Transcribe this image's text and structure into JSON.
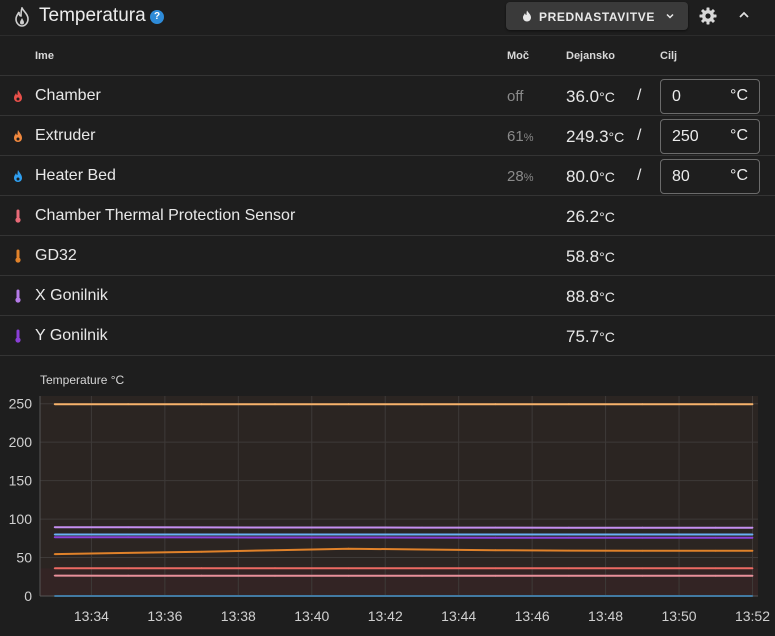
{
  "header": {
    "title": "Temperatura",
    "help_icon": "question-circle-icon",
    "help_glyph": "?",
    "preset_label": "PREDNASTAVITVE"
  },
  "table": {
    "columns": {
      "name": "Ime",
      "power": "Moč",
      "actual": "Dejansko",
      "target": "Cilj"
    },
    "rows": [
      {
        "name": "Chamber",
        "icon": "flame-icon",
        "color": "#e8504a",
        "power": "off",
        "power_unit": "",
        "actual": "36.0",
        "unit": "°C",
        "target": "0",
        "target_unit": "°C"
      },
      {
        "name": "Extruder",
        "icon": "flame-icon",
        "color": "#f0883e",
        "power": "61",
        "power_unit": "%",
        "actual": "249.3",
        "unit": "°C",
        "target": "250",
        "target_unit": "°C"
      },
      {
        "name": "Heater Bed",
        "icon": "flame-icon",
        "color": "#2f9ff0",
        "power": "28",
        "power_unit": "%",
        "actual": "80.0",
        "unit": "°C",
        "target": "80",
        "target_unit": "°C"
      },
      {
        "name": "Chamber Thermal Protection Sensor",
        "icon": "thermometer-icon",
        "color": "#e86a78",
        "actual": "26.2",
        "unit": "°C"
      },
      {
        "name": "GD32",
        "icon": "thermometer-icon",
        "color": "#e0822a",
        "actual": "58.8",
        "unit": "°C"
      },
      {
        "name": "X Gonilnik",
        "icon": "thermometer-icon",
        "color": "#b57be8",
        "actual": "88.8",
        "unit": "°C"
      },
      {
        "name": "Y Gonilnik",
        "icon": "thermometer-icon",
        "color": "#8a3fd6",
        "actual": "75.7",
        "unit": "°C"
      }
    ]
  },
  "chart_data": {
    "type": "line",
    "title": "Temperature °C",
    "xlabel": "",
    "ylabel": "",
    "ylim": [
      0,
      260
    ],
    "yticks": [
      0,
      50,
      100,
      150,
      200,
      250
    ],
    "xticks": [
      "13:34",
      "13:36",
      "13:38",
      "13:40",
      "13:42",
      "13:44",
      "13:46",
      "13:48",
      "13:50",
      "13:52"
    ],
    "x": [
      "13:33",
      "13:35",
      "13:37",
      "13:39",
      "13:41",
      "13:43",
      "13:45",
      "13:47",
      "13:49",
      "13:51",
      "13:52"
    ],
    "grid": true,
    "series": [
      {
        "name": "Extruder",
        "color": "#f6b26b",
        "values": [
          249.3,
          249.3,
          249.4,
          249.3,
          249.3,
          249.2,
          249.3,
          249.3,
          249.4,
          249.3,
          249.3
        ]
      },
      {
        "name": "X Gonilnik",
        "color": "#c48ff0",
        "values": [
          89.5,
          89.3,
          89.2,
          89.1,
          89.0,
          88.9,
          88.9,
          88.8,
          88.8,
          88.8,
          88.8
        ]
      },
      {
        "name": "Heater Bed",
        "color": "#6ab0f5",
        "values": [
          80.0,
          80.0,
          80.0,
          80.0,
          80.0,
          80.0,
          80.0,
          80.0,
          80.0,
          80.0,
          80.0
        ]
      },
      {
        "name": "Y Gonilnik",
        "color": "#8a3fd6",
        "values": [
          76.5,
          76.4,
          76.2,
          76.1,
          76.0,
          75.9,
          75.8,
          75.8,
          75.7,
          75.7,
          75.7
        ]
      },
      {
        "name": "GD32",
        "color": "#e0822a",
        "values": [
          54.5,
          56.0,
          57.5,
          59.5,
          61.5,
          60.5,
          59.5,
          59.0,
          58.8,
          58.8,
          58.8
        ]
      },
      {
        "name": "Chamber",
        "color": "#ec6a63",
        "values": [
          36.0,
          36.0,
          36.1,
          36.1,
          36.0,
          36.0,
          36.0,
          36.0,
          36.0,
          36.0,
          36.0
        ]
      },
      {
        "name": "Chamber Thermal Protection Sensor",
        "color": "#e8909a",
        "values": [
          26.5,
          26.4,
          26.4,
          26.3,
          26.3,
          26.2,
          26.2,
          26.2,
          26.2,
          26.2,
          26.2
        ]
      },
      {
        "name": "Chamber",
        "color": "#2f9ff0",
        "values": [
          0,
          0,
          0,
          0,
          0,
          0,
          0,
          0,
          0,
          0,
          0
        ]
      }
    ]
  }
}
